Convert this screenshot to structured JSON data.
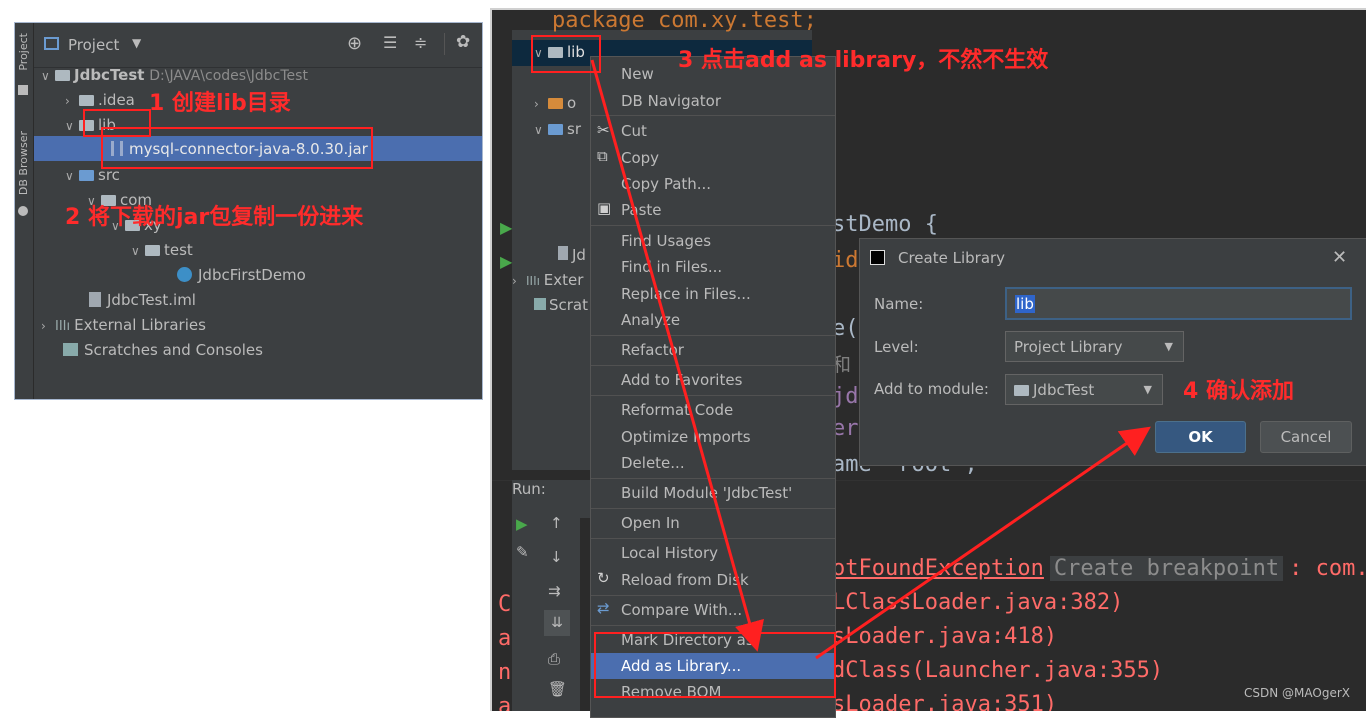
{
  "left_panel": {
    "strip_tabs": [
      "Project",
      "DB Browser"
    ],
    "header_label": "Project",
    "tree": {
      "root": "JdbcTest",
      "root_path": "D:\\JAVA\\codes\\JdbcTest",
      "idea": ".idea",
      "lib": "lib",
      "jar": "mysql-connector-java-8.0.30.jar",
      "src": "src",
      "com": "com",
      "xy": "xy",
      "test": "test",
      "class": "JdbcFirstDemo",
      "iml": "JdbcTest.iml",
      "ext": "External Libraries",
      "scratch": "Scratches and Consoles"
    },
    "annotation1": "1 创建lib目录",
    "annotation2": "2 将下载的jar包复制一份进来"
  },
  "right_panel": {
    "code_top": "package com.xy.test;",
    "tree": {
      "lib": "lib",
      "o": "o",
      "sr": "sr",
      "jd": "Jd",
      "ext": "Exter",
      "scratch": "Scrat"
    },
    "annotation3": "3 点击add as library，不然不生效",
    "annotation4": "4 确认添加",
    "code_lines": [
      "stDemo {",
      "id",
      "e(",
      "和",
      "jd",
      "er",
      "ame \"root\";"
    ],
    "run_label": "Run:",
    "console": [
      {
        "text": "otFoundException",
        "tail": "Create breakpoint",
        "tail2": ": com.m"
      },
      {
        "text": "LClassLoader.java:382)"
      },
      {
        "text": "sLoader.java:418)"
      },
      {
        "text": "dClass(Launcher.java:355)"
      },
      {
        "text": "sLoader.java:351)"
      }
    ],
    "console_left": [
      "C",
      "a",
      "n",
      "a"
    ],
    "context_menu": [
      "New",
      "DB Navigator",
      "Cut",
      "Copy",
      "Copy Path...",
      "Paste",
      "Find Usages",
      "Find in Files...",
      "Replace in Files...",
      "Analyze",
      "Refactor",
      "Add to Favorites",
      "Reformat Code",
      "Optimize Imports",
      "Delete...",
      "Build Module 'JdbcTest'",
      "Open In",
      "Local History",
      "Reload from Disk",
      "Compare With...",
      "Mark Directory as",
      "Add as Library...",
      "Remove BOM"
    ],
    "dialog": {
      "title": "Create Library",
      "name_label": "Name:",
      "name_value": "lib",
      "level_label": "Level:",
      "level_value": "Project Library",
      "module_label": "Add to module:",
      "module_value": "JdbcTest",
      "ok": "OK",
      "cancel": "Cancel"
    },
    "watermark": "CSDN @MAOgerX"
  },
  "colors": {
    "ide_bg": "#3c3f41",
    "editor_bg": "#2b2b2b",
    "selection": "#4b6eaf",
    "annotation_red": "#ff2b2b",
    "ok_button": "#365880"
  }
}
